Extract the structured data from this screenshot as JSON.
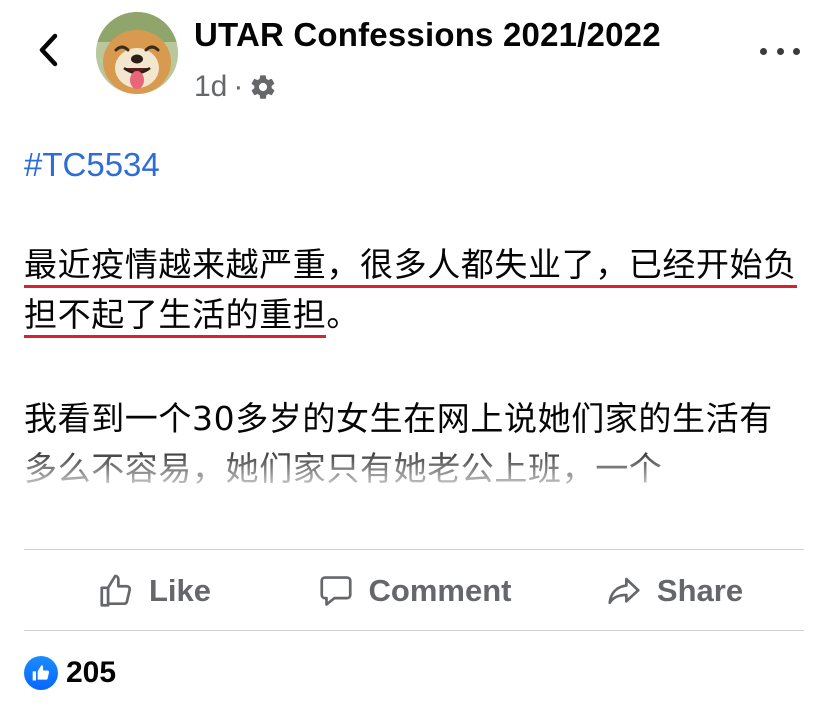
{
  "header": {
    "back_icon": "chevron-left-icon",
    "page_name": "UTAR Confessions 2021/2022",
    "time": "1d",
    "separator": "·",
    "privacy_icon": "gear-icon",
    "more_icon": "more-horizontal-icon"
  },
  "post": {
    "hashtag": "#TC5534",
    "paragraph1_underlined": "最近疫情越来越严重，很多人都失业了，已经开始负担不起了生活的重担",
    "paragraph1_end": "。",
    "paragraph2": "我看到一个30多岁的女生在网上说她们家的生活有多么不容易，她们家只有她老公上班，一个"
  },
  "actions": {
    "like_label": "Like",
    "comment_label": "Comment",
    "share_label": "Share"
  },
  "reactions": {
    "count": "205",
    "icon": "like-reaction-icon"
  },
  "colors": {
    "hashtag": "#2d6dd8",
    "underline": "#d8232f",
    "secondary_text": "#65676b",
    "like_blue": "#0866ff"
  }
}
